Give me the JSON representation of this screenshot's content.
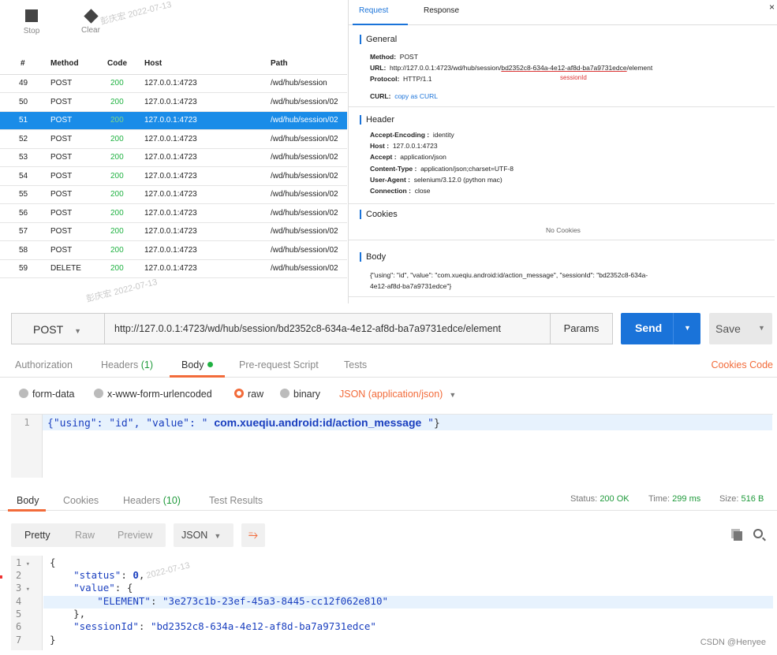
{
  "capture": {
    "toolbar": {
      "stop_label": "Stop",
      "clear_label": "Clear"
    },
    "columns": [
      "#",
      "Method",
      "Code",
      "Host",
      "Path"
    ],
    "rows": [
      {
        "num": "49",
        "method": "POST",
        "code": "200",
        "host": "127.0.0.1:4723",
        "path": "/wd/hub/session"
      },
      {
        "num": "50",
        "method": "POST",
        "code": "200",
        "host": "127.0.0.1:4723",
        "path": "/wd/hub/session/02"
      },
      {
        "num": "51",
        "method": "POST",
        "code": "200",
        "host": "127.0.0.1:4723",
        "path": "/wd/hub/session/02",
        "selected": true
      },
      {
        "num": "52",
        "method": "POST",
        "code": "200",
        "host": "127.0.0.1:4723",
        "path": "/wd/hub/session/02"
      },
      {
        "num": "53",
        "method": "POST",
        "code": "200",
        "host": "127.0.0.1:4723",
        "path": "/wd/hub/session/02"
      },
      {
        "num": "54",
        "method": "POST",
        "code": "200",
        "host": "127.0.0.1:4723",
        "path": "/wd/hub/session/02"
      },
      {
        "num": "55",
        "method": "POST",
        "code": "200",
        "host": "127.0.0.1:4723",
        "path": "/wd/hub/session/02"
      },
      {
        "num": "56",
        "method": "POST",
        "code": "200",
        "host": "127.0.0.1:4723",
        "path": "/wd/hub/session/02"
      },
      {
        "num": "57",
        "method": "POST",
        "code": "200",
        "host": "127.0.0.1:4723",
        "path": "/wd/hub/session/02"
      },
      {
        "num": "58",
        "method": "POST",
        "code": "200",
        "host": "127.0.0.1:4723",
        "path": "/wd/hub/session/02"
      },
      {
        "num": "59",
        "method": "DELETE",
        "code": "200",
        "host": "127.0.0.1:4723",
        "path": "/wd/hub/session/02"
      }
    ]
  },
  "detail": {
    "tabs": {
      "request": "Request",
      "response": "Response"
    },
    "close": "×",
    "general": {
      "title": "General",
      "method_key": "Method:",
      "method_val": "POST",
      "url_key": "URL:",
      "url_prefix": "http://127.0.0.1:4723/wd/hub/session/",
      "url_session": "bd2352c8-634a-4e12-af8d-ba7a9731edce",
      "url_suffix": "/element",
      "session_note": "sessionId",
      "protocol_key": "Protocol:",
      "protocol_val": "HTTP/1.1",
      "curl_key": "CURL:",
      "curl_val": "copy as CURL"
    },
    "header": {
      "title": "Header",
      "items": [
        {
          "k": "Accept-Encoding :",
          "v": "identity"
        },
        {
          "k": "Host :",
          "v": "127.0.0.1:4723"
        },
        {
          "k": "Accept :",
          "v": "application/json"
        },
        {
          "k": "Content-Type :",
          "v": "application/json;charset=UTF-8"
        },
        {
          "k": "User-Agent :",
          "v": "selenium/3.12.0 (python mac)"
        },
        {
          "k": "Connection :",
          "v": "close"
        }
      ]
    },
    "cookies": {
      "title": "Cookies",
      "empty": "No Cookies"
    },
    "body": {
      "title": "Body",
      "line1": "{\"using\": \"id\", \"value\": \"com.xueqiu.android:id/action_message\", \"sessionId\": \"bd2352c8-634a-",
      "line2": "4e12-af8d-ba7a9731edce\"}"
    }
  },
  "watermark": {
    "name": "彭庆宏",
    "date": "2022-07-13"
  },
  "request": {
    "method": "POST",
    "url": "http://127.0.0.1:4723/wd/hub/session/bd2352c8-634a-4e12-af8d-ba7a9731edce/element",
    "params_label": "Params",
    "send_label": "Send",
    "save_label": "Save",
    "tabs": {
      "authorization": "Authorization",
      "headers": "Headers",
      "headers_count": "(1)",
      "body": "Body",
      "prerequest": "Pre-request Script",
      "tests": "Tests"
    },
    "links": {
      "cookies": "Cookies",
      "code": "Code"
    },
    "body_modes": {
      "form_data": "form-data",
      "urlencoded": "x-www-form-urlencoded",
      "raw": "raw",
      "binary": "binary",
      "format": "JSON (application/json)"
    },
    "editor": {
      "line_no": "1",
      "prefix": "{\"using\": \"id\", \"value\": \" ",
      "highlight": "com.xueqiu.android:id/action_message",
      "suffix": " \"",
      "close": "}"
    }
  },
  "response": {
    "tabs": {
      "body": "Body",
      "cookies": "Cookies",
      "headers": "Headers",
      "headers_count": "(10)",
      "tests": "Test Results"
    },
    "status_label": "Status:",
    "status_val": "200 OK",
    "time_label": "Time:",
    "time_val": "299 ms",
    "size_label": "Size:",
    "size_val": "516 B",
    "views": {
      "pretty": "Pretty",
      "raw": "Raw",
      "preview": "Preview",
      "format": "JSON"
    },
    "lines": [
      "1",
      "2",
      "3",
      "4",
      "5",
      "6",
      "7"
    ],
    "json": {
      "status_key": "\"status\"",
      "status_val": "0",
      "value_key": "\"value\"",
      "element_key": "\"ELEMENT\"",
      "element_val": "\"3e273c1b-23ef-45a3-8445-cc12f062e810\"",
      "session_key": "\"sessionId\"",
      "session_val": "\"bd2352c8-634a-4e12-af8d-ba7a9731edce\""
    },
    "credit": "CSDN @Henyee"
  }
}
